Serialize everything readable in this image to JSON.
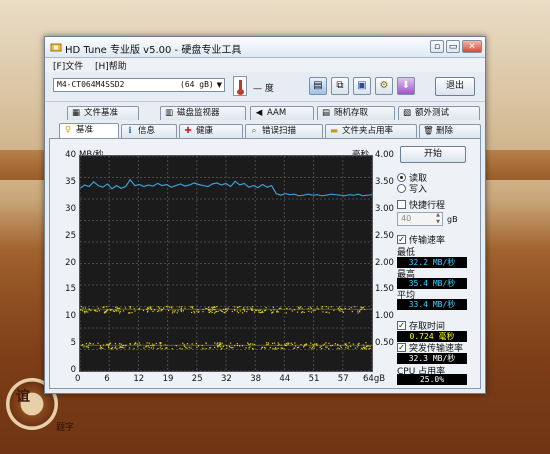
{
  "window": {
    "title": "HD Tune 专业版 v5.00 - 硬盘专业工具",
    "controls": [
      "▫",
      "▭",
      "✕"
    ]
  },
  "menu": [
    "[F]文件",
    "[H]帮助"
  ],
  "toolbar": {
    "drive": "M4-CT064M4SSD2",
    "drive_size": "(64 gB)",
    "temperature": "— 度",
    "exit_label": "退出",
    "icons": [
      "copy-text-icon",
      "copy-icon",
      "save-icon",
      "options-icon",
      "download-icon"
    ]
  },
  "tabs_top": [
    {
      "label": "文件基准",
      "icon": "file-benchmark-icon"
    },
    {
      "label": "磁盘监视器",
      "icon": "disk-monitor-icon"
    },
    {
      "label": "AAM",
      "icon": "aam-icon"
    },
    {
      "label": "随机存取",
      "icon": "random-access-icon"
    },
    {
      "label": "额外测试",
      "icon": "extra-tests-icon"
    }
  ],
  "tabs_bottom": [
    {
      "label": "基准",
      "icon": "benchmark-icon",
      "active": true
    },
    {
      "label": "信息",
      "icon": "info-icon"
    },
    {
      "label": "健康",
      "icon": "health-icon"
    },
    {
      "label": "错误扫描",
      "icon": "error-scan-icon"
    },
    {
      "label": "文件夹占用率",
      "icon": "folder-usage-icon"
    },
    {
      "label": "删除",
      "icon": "erase-icon"
    }
  ],
  "chart_data": {
    "type": "line",
    "ylabel": "MB/秒",
    "y2label": "毫秒",
    "ylim": [
      0,
      40
    ],
    "y2lim": [
      0,
      4
    ],
    "xlim": [
      0,
      64
    ],
    "xunit": "gB",
    "yticks": [
      "40",
      "35",
      "30",
      "25",
      "20",
      "15",
      "10",
      "5",
      "0"
    ],
    "y2ticks": [
      "4.00",
      "3.50",
      "3.00",
      "2.50",
      "2.00",
      "1.50",
      "1.00",
      "0.50",
      ""
    ],
    "xticks": [
      "0",
      "6",
      "12",
      "19",
      "25",
      "32",
      "38",
      "44",
      "51",
      "57",
      "64gB"
    ],
    "transfer_rate": {
      "color": "#3f9bd1",
      "x": [
        0,
        1,
        2,
        3,
        4,
        5,
        6,
        7,
        8,
        9,
        10,
        11,
        12,
        13,
        14,
        15,
        16,
        17,
        18,
        19,
        20,
        21,
        22,
        23,
        24,
        25,
        26,
        27,
        28,
        29,
        30,
        31,
        32,
        33,
        34,
        35,
        36,
        37,
        38,
        39,
        40,
        41,
        42,
        43,
        44,
        45,
        46,
        47,
        48,
        49,
        50,
        51,
        52,
        53,
        54,
        55,
        56,
        57,
        58,
        59,
        60,
        61,
        62,
        63,
        64
      ],
      "y": [
        34.0,
        34.6,
        34.3,
        35.2,
        34.5,
        34.2,
        34.8,
        33.9,
        34.5,
        34.0,
        34.3,
        35.6,
        34.5,
        34.7,
        34.3,
        34.6,
        34.4,
        34.9,
        34.5,
        34.7,
        34.2,
        34.5,
        34.8,
        34.4,
        34.6,
        35.0,
        34.7,
        34.5,
        34.3,
        34.8,
        35.0,
        34.6,
        34.9,
        34.3,
        35.3,
        34.6,
        34.9,
        34.2,
        34.5,
        34.1,
        34.7,
        34.2,
        34.5,
        33.0,
        32.7,
        33.0,
        32.8,
        32.9,
        32.6,
        32.7,
        32.9,
        32.7,
        32.8,
        32.6,
        32.7,
        32.9,
        32.8,
        32.7,
        32.6,
        32.8,
        32.7,
        32.9,
        32.6,
        32.7,
        32.8
      ]
    },
    "access_time": {
      "color": "#d9d12a",
      "upper_band_ms": 1.15,
      "lower_band_ms": 0.48
    }
  },
  "side": {
    "start_label": "开始",
    "read_label": "读取",
    "write_label": "写入",
    "short_stroke_label": "快捷行程",
    "short_stroke_value": "40",
    "short_stroke_unit": "gB",
    "transfer_rate_label": "传输速率",
    "min_label": "最低",
    "min_value": "32.2 MB/秒",
    "max_label": "最高",
    "max_value": "35.4 MB/秒",
    "avg_label": "平均",
    "avg_value": "33.4 MB/秒",
    "access_time_label": "存取时间",
    "access_time_value": "0.724 毫秒",
    "burst_label": "突发传输速率",
    "burst_value": "32.3 MB/秒",
    "cpu_label": "CPU 占用率",
    "cpu_value": "25.0%"
  },
  "watermark": {
    "text": "题字"
  }
}
